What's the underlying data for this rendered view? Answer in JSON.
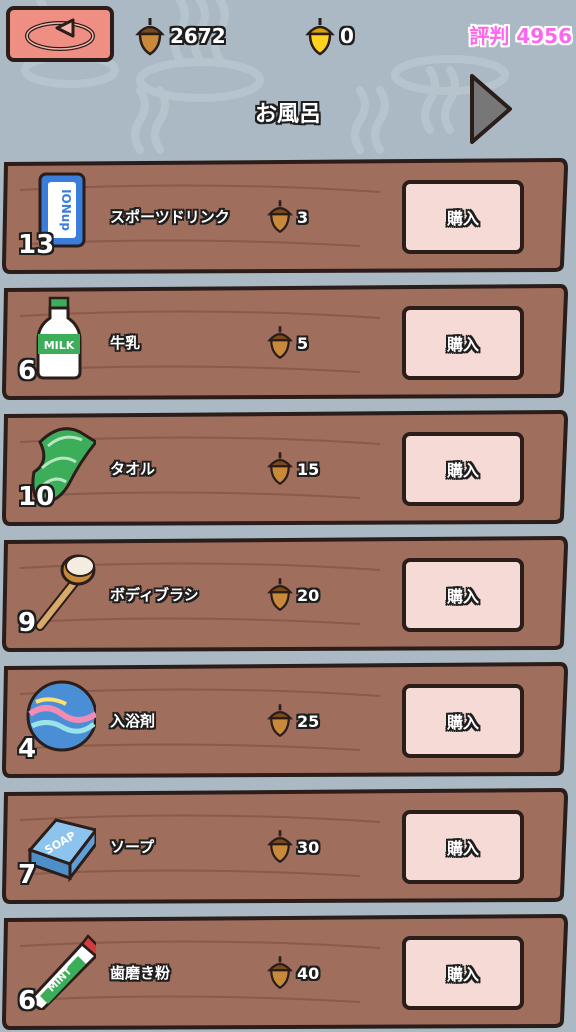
{
  "header": {
    "acorns": "2672",
    "golden_acorns": "0",
    "reputation": "評判 4956",
    "category_title": "お風呂"
  },
  "items": [
    {
      "icon": "sports-drink-icon",
      "label_on_icon": "IONup",
      "quantity": "13",
      "name": "スポーツドリンク",
      "price": "3",
      "buy_label": "購入"
    },
    {
      "icon": "milk-bottle-icon",
      "label_on_icon": "MILK",
      "quantity": "6",
      "name": "牛乳",
      "price": "5",
      "buy_label": "購入"
    },
    {
      "icon": "towel-icon",
      "quantity": "10",
      "name": "タオル",
      "price": "15",
      "buy_label": "購入"
    },
    {
      "icon": "body-brush-icon",
      "quantity": "9",
      "name": "ボディブラシ",
      "price": "20",
      "buy_label": "購入"
    },
    {
      "icon": "bath-bomb-icon",
      "quantity": "4",
      "name": "入浴剤",
      "price": "25",
      "buy_label": "購入"
    },
    {
      "icon": "soap-icon",
      "label_on_icon": "SOAP",
      "quantity": "7",
      "name": "ソープ",
      "price": "30",
      "buy_label": "購入"
    },
    {
      "icon": "toothpaste-icon",
      "label_on_icon": "MINT",
      "quantity": "6",
      "name": "歯磨き粉",
      "price": "40",
      "buy_label": "購入"
    }
  ],
  "colors": {
    "background": "#aab9c3",
    "wood": "#a06e5d",
    "button": "#f6dad5",
    "back_button": "#ef8e83",
    "reputation": "#ff66ee"
  }
}
